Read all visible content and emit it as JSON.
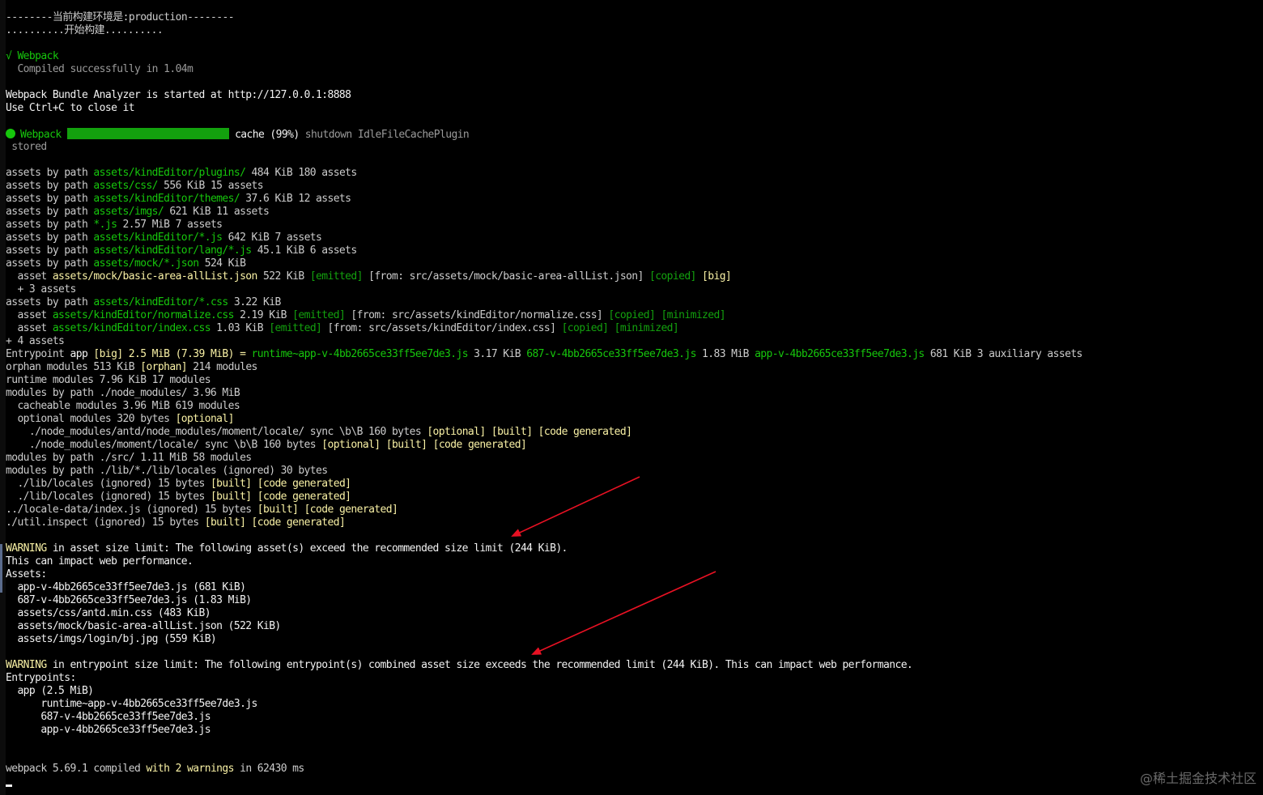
{
  "terminal": {
    "lines": [
      {
        "segments": [
          {
            "text": "--------当前构建环境是:production--------",
            "color": "default"
          }
        ]
      },
      {
        "segments": [
          {
            "text": "..........开始构建..........",
            "color": "default"
          }
        ]
      },
      {
        "segments": []
      },
      {
        "segments": [
          {
            "text": "√ Webpack",
            "color": "green"
          }
        ]
      },
      {
        "segments": [
          {
            "text": "  Compiled successfully in 1.04m",
            "color": "gray"
          }
        ]
      },
      {
        "segments": []
      },
      {
        "segments": [
          {
            "text": "Webpack Bundle Analyzer is started at http://127.0.0.1:8888",
            "color": "white"
          }
        ]
      },
      {
        "segments": [
          {
            "text": "Use Ctrl+C to close it",
            "color": "white"
          }
        ]
      },
      {
        "segments": []
      },
      {
        "progress": true
      },
      {
        "segments": [
          {
            "text": " stored",
            "color": "gray"
          }
        ]
      },
      {
        "segments": []
      },
      {
        "segments": [
          {
            "text": "assets by path ",
            "color": "default"
          },
          {
            "text": "assets/kindEditor/plugins/",
            "color": "green"
          },
          {
            "text": " 484 KiB 180 assets",
            "color": "default"
          }
        ]
      },
      {
        "segments": [
          {
            "text": "assets by path ",
            "color": "default"
          },
          {
            "text": "assets/css/",
            "color": "green"
          },
          {
            "text": " 556 KiB 15 assets",
            "color": "default"
          }
        ]
      },
      {
        "segments": [
          {
            "text": "assets by path ",
            "color": "default"
          },
          {
            "text": "assets/kindEditor/themes/",
            "color": "green"
          },
          {
            "text": " 37.6 KiB 12 assets",
            "color": "default"
          }
        ]
      },
      {
        "segments": [
          {
            "text": "assets by path ",
            "color": "default"
          },
          {
            "text": "assets/imgs/",
            "color": "green"
          },
          {
            "text": " 621 KiB 11 assets",
            "color": "default"
          }
        ]
      },
      {
        "segments": [
          {
            "text": "assets by path ",
            "color": "default"
          },
          {
            "text": "*.js",
            "color": "green"
          },
          {
            "text": " 2.57 MiB 7 assets",
            "color": "default"
          }
        ]
      },
      {
        "segments": [
          {
            "text": "assets by path ",
            "color": "default"
          },
          {
            "text": "assets/kindEditor/*.js",
            "color": "green"
          },
          {
            "text": " 642 KiB 7 assets",
            "color": "default"
          }
        ]
      },
      {
        "segments": [
          {
            "text": "assets by path ",
            "color": "default"
          },
          {
            "text": "assets/kindEditor/lang/*.js",
            "color": "green"
          },
          {
            "text": " 45.1 KiB 6 assets",
            "color": "default"
          }
        ]
      },
      {
        "segments": [
          {
            "text": "assets by path ",
            "color": "default"
          },
          {
            "text": "assets/mock/*.json",
            "color": "green"
          },
          {
            "text": " 524 KiB",
            "color": "default"
          }
        ]
      },
      {
        "segments": [
          {
            "text": "  asset ",
            "color": "default"
          },
          {
            "text": "assets/mock/basic-area-allList.json",
            "color": "yellow"
          },
          {
            "text": " 522 KiB ",
            "color": "default"
          },
          {
            "text": "[emitted]",
            "color": "darkgreen"
          },
          {
            "text": " [from: src/assets/mock/basic-area-allList.json] ",
            "color": "default"
          },
          {
            "text": "[copied]",
            "color": "darkgreen"
          },
          {
            "text": " [big]",
            "color": "yellow"
          }
        ]
      },
      {
        "segments": [
          {
            "text": "  + 3 assets",
            "color": "default"
          }
        ]
      },
      {
        "segments": [
          {
            "text": "assets by path ",
            "color": "default"
          },
          {
            "text": "assets/kindEditor/*.css",
            "color": "green"
          },
          {
            "text": " 3.22 KiB",
            "color": "default"
          }
        ]
      },
      {
        "segments": [
          {
            "text": "  asset ",
            "color": "default"
          },
          {
            "text": "assets/kindEditor/normalize.css",
            "color": "green"
          },
          {
            "text": " 2.19 KiB ",
            "color": "default"
          },
          {
            "text": "[emitted]",
            "color": "darkgreen"
          },
          {
            "text": " [from: src/assets/kindEditor/normalize.css] ",
            "color": "default"
          },
          {
            "text": "[copied]",
            "color": "darkgreen"
          },
          {
            "text": " ",
            "color": "default"
          },
          {
            "text": "[minimized]",
            "color": "darkgreen"
          }
        ]
      },
      {
        "segments": [
          {
            "text": "  asset ",
            "color": "default"
          },
          {
            "text": "assets/kindEditor/index.css",
            "color": "green"
          },
          {
            "text": " 1.03 KiB ",
            "color": "default"
          },
          {
            "text": "[emitted]",
            "color": "darkgreen"
          },
          {
            "text": " [from: src/assets/kindEditor/index.css] ",
            "color": "default"
          },
          {
            "text": "[copied]",
            "color": "darkgreen"
          },
          {
            "text": " ",
            "color": "default"
          },
          {
            "text": "[minimized]",
            "color": "darkgreen"
          }
        ]
      },
      {
        "segments": [
          {
            "text": "+ 4 assets",
            "color": "default"
          }
        ]
      },
      {
        "segments": [
          {
            "text": "Entrypoint ",
            "color": "default"
          },
          {
            "text": "app",
            "color": "white"
          },
          {
            "text": " [big] 2.5 MiB (7.39 MiB) = ",
            "color": "yellow"
          },
          {
            "text": "runtime~app-v-4bb2665ce33ff5ee7de3.js",
            "color": "green"
          },
          {
            "text": " 3.17 KiB ",
            "color": "default"
          },
          {
            "text": "687-v-4bb2665ce33ff5ee7de3.js",
            "color": "green"
          },
          {
            "text": " 1.83 MiB ",
            "color": "default"
          },
          {
            "text": "app-v-4bb2665ce33ff5ee7de3.js",
            "color": "green"
          },
          {
            "text": " 681 KiB 3 auxiliary assets",
            "color": "default"
          }
        ]
      },
      {
        "segments": [
          {
            "text": "orphan modules 513 KiB ",
            "color": "default"
          },
          {
            "text": "[orphan]",
            "color": "yellow"
          },
          {
            "text": " 214 modules",
            "color": "default"
          }
        ]
      },
      {
        "segments": [
          {
            "text": "runtime modules 7.96 KiB 17 modules",
            "color": "default"
          }
        ]
      },
      {
        "segments": [
          {
            "text": "modules by path ./node_modules/ 3.96 MiB",
            "color": "default"
          }
        ]
      },
      {
        "segments": [
          {
            "text": "  cacheable modules 3.96 MiB 619 modules",
            "color": "default"
          }
        ]
      },
      {
        "segments": [
          {
            "text": "  optional modules 320 bytes ",
            "color": "default"
          },
          {
            "text": "[optional]",
            "color": "yellow"
          }
        ]
      },
      {
        "segments": [
          {
            "text": "    ./node_modules/antd/node_modules/moment/locale/ sync \\b\\B 160 bytes ",
            "color": "default"
          },
          {
            "text": "[optional]",
            "color": "yellow"
          },
          {
            "text": " ",
            "color": "default"
          },
          {
            "text": "[built]",
            "color": "yellow"
          },
          {
            "text": " ",
            "color": "default"
          },
          {
            "text": "[code generated]",
            "color": "yellow"
          }
        ]
      },
      {
        "segments": [
          {
            "text": "    ./node_modules/moment/locale/ sync \\b\\B 160 bytes ",
            "color": "default"
          },
          {
            "text": "[optional]",
            "color": "yellow"
          },
          {
            "text": " ",
            "color": "default"
          },
          {
            "text": "[built]",
            "color": "yellow"
          },
          {
            "text": " ",
            "color": "default"
          },
          {
            "text": "[code generated]",
            "color": "yellow"
          }
        ]
      },
      {
        "segments": [
          {
            "text": "modules by path ./src/ 1.11 MiB 58 modules",
            "color": "default"
          }
        ]
      },
      {
        "segments": [
          {
            "text": "modules by path ./lib/*./lib/locales (ignored) 30 bytes",
            "color": "default"
          }
        ]
      },
      {
        "segments": [
          {
            "text": "  ./lib/locales (ignored) 15 bytes ",
            "color": "default"
          },
          {
            "text": "[built]",
            "color": "yellow"
          },
          {
            "text": " ",
            "color": "default"
          },
          {
            "text": "[code generated]",
            "color": "yellow"
          }
        ]
      },
      {
        "segments": [
          {
            "text": "  ./lib/locales (ignored) 15 bytes ",
            "color": "default"
          },
          {
            "text": "[built]",
            "color": "yellow"
          },
          {
            "text": " ",
            "color": "default"
          },
          {
            "text": "[code generated]",
            "color": "yellow"
          }
        ]
      },
      {
        "segments": [
          {
            "text": "../locale-data/index.js (ignored) 15 bytes ",
            "color": "default"
          },
          {
            "text": "[built]",
            "color": "yellow"
          },
          {
            "text": " ",
            "color": "default"
          },
          {
            "text": "[code generated]",
            "color": "yellow"
          }
        ]
      },
      {
        "segments": [
          {
            "text": "./util.inspect (ignored) 15 bytes ",
            "color": "default"
          },
          {
            "text": "[built]",
            "color": "yellow"
          },
          {
            "text": " ",
            "color": "default"
          },
          {
            "text": "[code generated]",
            "color": "yellow"
          }
        ]
      },
      {
        "segments": []
      },
      {
        "segments": [
          {
            "text": "WARNING",
            "color": "yellow"
          },
          {
            "text": " in asset size limit: The following asset(s) exceed the recommended size limit (244 KiB).",
            "color": "white"
          }
        ]
      },
      {
        "segments": [
          {
            "text": "This can impact web performance.",
            "color": "white"
          }
        ]
      },
      {
        "segments": [
          {
            "text": "Assets:",
            "color": "white"
          }
        ]
      },
      {
        "segments": [
          {
            "text": "  app-v-4bb2665ce33ff5ee7de3.js (681 KiB)",
            "color": "white"
          }
        ]
      },
      {
        "segments": [
          {
            "text": "  687-v-4bb2665ce33ff5ee7de3.js (1.83 MiB)",
            "color": "white"
          }
        ]
      },
      {
        "segments": [
          {
            "text": "  assets/css/antd.min.css (483 KiB)",
            "color": "white"
          }
        ]
      },
      {
        "segments": [
          {
            "text": "  assets/mock/basic-area-allList.json (522 KiB)",
            "color": "white"
          }
        ]
      },
      {
        "segments": [
          {
            "text": "  assets/imgs/login/bj.jpg (559 KiB)",
            "color": "white"
          }
        ]
      },
      {
        "segments": []
      },
      {
        "segments": [
          {
            "text": "WARNING",
            "color": "yellow"
          },
          {
            "text": " in entrypoint size limit: The following entrypoint(s) combined asset size exceeds the recommended limit (244 KiB). This can impact web performance.",
            "color": "white"
          }
        ]
      },
      {
        "segments": [
          {
            "text": "Entrypoints:",
            "color": "white"
          }
        ]
      },
      {
        "segments": [
          {
            "text": "  app (2.5 MiB)",
            "color": "white"
          }
        ]
      },
      {
        "segments": [
          {
            "text": "      runtime~app-v-4bb2665ce33ff5ee7de3.js",
            "color": "white"
          }
        ]
      },
      {
        "segments": [
          {
            "text": "      687-v-4bb2665ce33ff5ee7de3.js",
            "color": "white"
          }
        ]
      },
      {
        "segments": [
          {
            "text": "      app-v-4bb2665ce33ff5ee7de3.js",
            "color": "white"
          }
        ]
      },
      {
        "segments": []
      },
      {
        "segments": []
      },
      {
        "segments": [
          {
            "text": "webpack 5.69.1 compiled ",
            "color": "default"
          },
          {
            "text": "with ",
            "color": "yellow"
          },
          {
            "text": "2 warnings",
            "color": "yellow"
          },
          {
            "text": " in 62430 ms",
            "color": "default"
          }
        ]
      }
    ],
    "progress": {
      "label": "Webpack",
      "percent": 99,
      "text": "cache (99%) ",
      "detail": "shutdown IdleFileCachePlugin"
    }
  },
  "watermark": "@稀土掘金技术社区",
  "colors": {
    "background": "#000000",
    "default": "#cccccc",
    "green": "#16c60c",
    "darkgreen": "#13a10e",
    "yellow": "#f9f1a5",
    "white": "#f2f2f2",
    "gray": "#9a9a9a",
    "annotation_arrow": "#e81123"
  }
}
